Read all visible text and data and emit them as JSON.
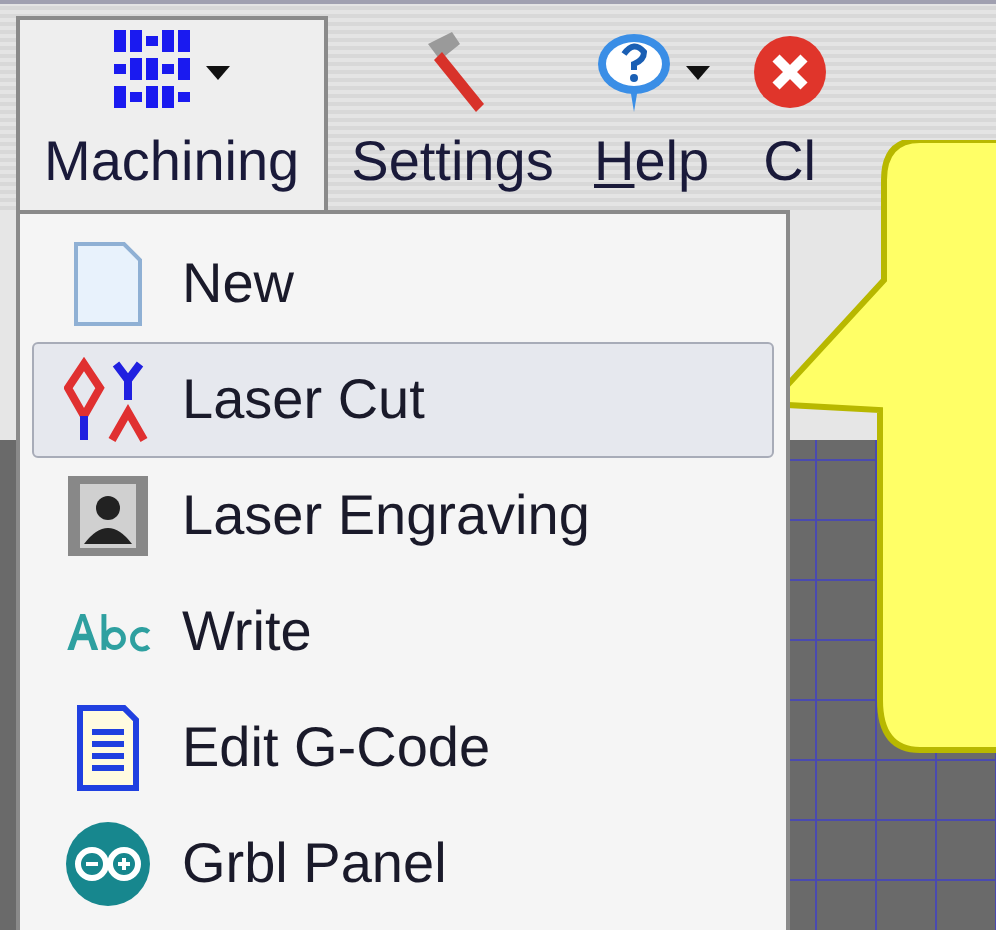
{
  "toolbar": [
    {
      "label": "Machining",
      "kind": "logo",
      "pressed": true,
      "dropdown": true,
      "underline_first": false
    },
    {
      "label": "Settings",
      "kind": "hammer",
      "pressed": false,
      "dropdown": false,
      "underline_first": false
    },
    {
      "label": "Help",
      "kind": "help",
      "pressed": false,
      "dropdown": true,
      "underline_first": true
    },
    {
      "label": "Cl",
      "kind": "close",
      "pressed": false,
      "dropdown": false,
      "underline_first": false
    }
  ],
  "menu": {
    "items": [
      {
        "label": "New",
        "kind": "page",
        "highlighted": false
      },
      {
        "label": "Laser Cut",
        "kind": "lasercut",
        "highlighted": true
      },
      {
        "label": "Laser Engraving",
        "kind": "portrait",
        "highlighted": false
      },
      {
        "label": "Write",
        "kind": "abc",
        "highlighted": false
      },
      {
        "label": "Edit G-Code",
        "kind": "doc",
        "highlighted": false
      },
      {
        "label": "Grbl Panel",
        "kind": "board",
        "highlighted": false
      }
    ]
  }
}
